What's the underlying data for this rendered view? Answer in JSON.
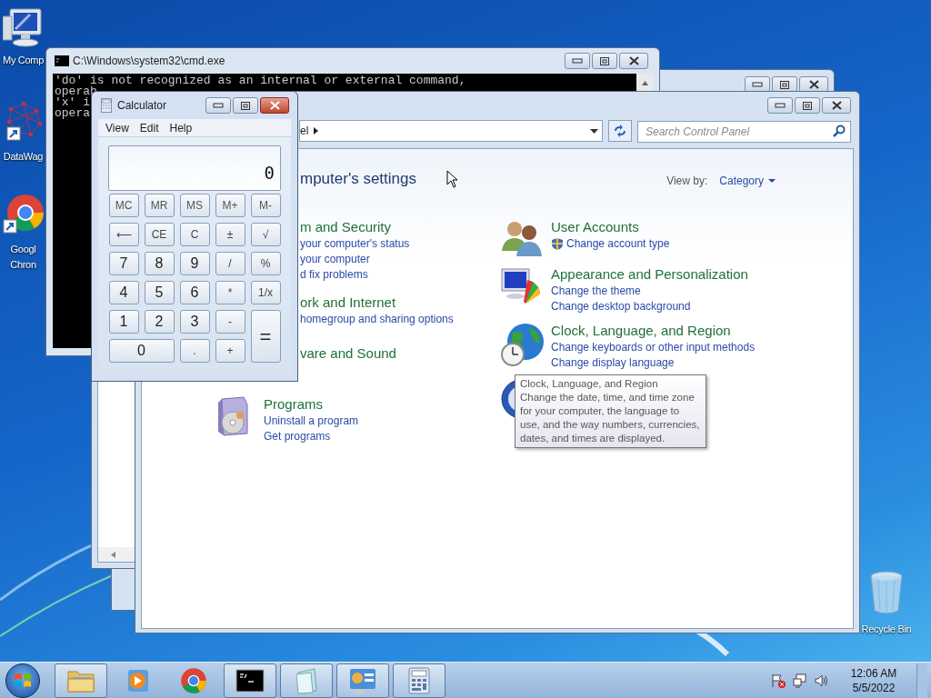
{
  "desktop_icons": [
    {
      "kind": "computer",
      "label": "My Comp"
    },
    {
      "kind": "graph-shortcut",
      "label": "DataWag"
    },
    {
      "kind": "chrome-shortcut",
      "label": "Googl\nChron"
    },
    {
      "kind": "recycle-bin",
      "label": "Recycle Bin"
    }
  ],
  "cmd": {
    "title": "C:\\Windows\\system32\\cmd.exe",
    "lines": [
      "'do' is not recognized as an internal or external command,",
      "operab",
      "'x' i",
      "opera"
    ]
  },
  "control_panel": {
    "address": "el",
    "search": {
      "placeholder": "Search Control Panel"
    },
    "heading": "mputer's settings",
    "view_by": {
      "label": "View by:",
      "value": "Category"
    },
    "columns": [
      [
        {
          "kind": "security",
          "covered": true,
          "title": "m and Security",
          "links": [
            {
              "text": "your computer's status",
              "shield": false
            },
            {
              "text": "your computer",
              "shield": false
            },
            {
              "text": "d fix problems",
              "shield": false
            }
          ]
        },
        {
          "kind": "network",
          "covered": true,
          "title": "ork and Internet",
          "links": [
            {
              "text": "homegroup and sharing options",
              "shield": false
            }
          ]
        },
        {
          "kind": "sound",
          "covered": true,
          "title": "vare and Sound"
        },
        {
          "kind": "programs",
          "covered": false,
          "title": "Programs",
          "links": [
            {
              "text": "Uninstall a program",
              "shield": false
            },
            {
              "text": "Get programs",
              "shield": false
            }
          ]
        }
      ],
      [
        {
          "kind": "users",
          "covered": false,
          "title": "User Accounts",
          "links": [
            {
              "text": "Change account type",
              "shield": true
            }
          ]
        },
        {
          "kind": "appearance",
          "covered": false,
          "title": "Appearance and Personalization",
          "links": [
            {
              "text": "Change the theme",
              "shield": false
            },
            {
              "text": "Change desktop background",
              "shield": false
            }
          ]
        },
        {
          "kind": "clock",
          "covered": false,
          "title": "Clock, Language, and Region",
          "links": [
            {
              "text": "Change keyboards or other input methods",
              "shield": false
            },
            {
              "text": "Change display language",
              "shield": false
            }
          ]
        },
        {
          "kind": "ease",
          "covered": false
        }
      ]
    ]
  },
  "tooltip": {
    "title": "Clock, Language, and Region",
    "text": "Change the date, time, and time zone for your computer, the language to use, and the way numbers, currencies, dates, and times are displayed."
  },
  "calculator": {
    "title": "Calculator",
    "menu": [
      "View",
      "Edit",
      "Help"
    ],
    "display": "0",
    "keys": [
      {
        "label": "MC",
        "kind": "memory"
      },
      {
        "label": "MR",
        "kind": "memory"
      },
      {
        "label": "MS",
        "kind": "memory"
      },
      {
        "label": "M+",
        "kind": "memory"
      },
      {
        "label": "M-",
        "kind": "memory"
      },
      {
        "label": "⟵",
        "kind": "function"
      },
      {
        "label": "CE",
        "kind": "function"
      },
      {
        "label": "C",
        "kind": "function"
      },
      {
        "label": "±",
        "kind": "function"
      },
      {
        "label": "√",
        "kind": "function"
      },
      {
        "label": "7",
        "kind": "digit"
      },
      {
        "label": "8",
        "kind": "digit"
      },
      {
        "label": "9",
        "kind": "digit"
      },
      {
        "label": "/",
        "kind": "function"
      },
      {
        "label": "%",
        "kind": "function"
      },
      {
        "label": "4",
        "kind": "digit"
      },
      {
        "label": "5",
        "kind": "digit"
      },
      {
        "label": "6",
        "kind": "digit"
      },
      {
        "label": "*",
        "kind": "function"
      },
      {
        "label": "1/x",
        "kind": "function"
      },
      {
        "label": "1",
        "kind": "digit"
      },
      {
        "label": "2",
        "kind": "digit"
      },
      {
        "label": "3",
        "kind": "digit"
      },
      {
        "label": "-",
        "kind": "function"
      },
      {
        "label": "=",
        "kind": "tall"
      },
      {
        "label": "0",
        "kind": "wide"
      },
      {
        "label": ".",
        "kind": "function"
      },
      {
        "label": "+",
        "kind": "function"
      }
    ]
  },
  "taskbar": {
    "items": [
      {
        "kind": "explorer",
        "open": true
      },
      {
        "kind": "media-player",
        "open": false
      },
      {
        "kind": "chrome",
        "open": false
      },
      {
        "kind": "console",
        "open": true
      },
      {
        "kind": "notepad",
        "open": true
      },
      {
        "kind": "control-panel",
        "open": true
      },
      {
        "kind": "calculator",
        "open": true
      }
    ],
    "clock": {
      "time": "12:06 AM",
      "date": "5/5/2022"
    }
  }
}
